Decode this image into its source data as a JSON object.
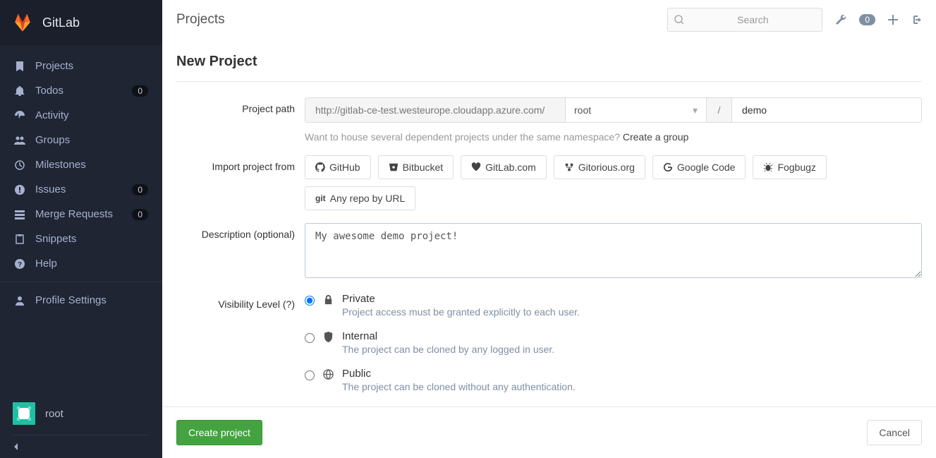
{
  "brand": "GitLab",
  "sidebar": {
    "items": [
      {
        "label": "Projects",
        "icon": "bookmark-icon"
      },
      {
        "label": "Todos",
        "icon": "bell-icon",
        "badge": "0"
      },
      {
        "label": "Activity",
        "icon": "dashboard-icon"
      },
      {
        "label": "Groups",
        "icon": "group-icon"
      },
      {
        "label": "Milestones",
        "icon": "clock-icon"
      },
      {
        "label": "Issues",
        "icon": "exclamation-icon",
        "badge": "0"
      },
      {
        "label": "Merge Requests",
        "icon": "tasks-icon",
        "badge": "0"
      },
      {
        "label": "Snippets",
        "icon": "clipboard-icon"
      },
      {
        "label": "Help",
        "icon": "question-icon"
      }
    ],
    "profile": "Profile Settings",
    "user": "root"
  },
  "topbar": {
    "title": "Projects",
    "search_placeholder": "Search",
    "todos_count": "0"
  },
  "page": {
    "title": "New Project",
    "labels": {
      "project_path": "Project path",
      "import_from": "Import project from",
      "description": "Description (optional)",
      "visibility": "Visibility Level (?)"
    },
    "path": {
      "base_url": "http://gitlab-ce-test.westeurope.cloudapp.azure.com/",
      "namespace": "root",
      "separator": "/",
      "name": "demo"
    },
    "hint_text": "Want to house several dependent projects under the same namespace? ",
    "hint_link": "Create a group",
    "imports": [
      {
        "label": "GitHub",
        "icon": "github-icon"
      },
      {
        "label": "Bitbucket",
        "icon": "bitbucket-icon"
      },
      {
        "label": "GitLab.com",
        "icon": "heart-icon"
      },
      {
        "label": "Gitorious.org",
        "icon": "gitorious-icon"
      },
      {
        "label": "Google Code",
        "icon": "google-icon"
      },
      {
        "label": "Fogbugz",
        "icon": "bug-icon"
      },
      {
        "label": "Any repo by URL",
        "icon": "git-icon",
        "prefix": "git"
      }
    ],
    "description_value": "My awesome demo project!",
    "visibility": [
      {
        "title": "Private",
        "desc": "Project access must be granted explicitly to each user.",
        "icon": "lock-icon",
        "checked": true
      },
      {
        "title": "Internal",
        "desc": "The project can be cloned by any logged in user.",
        "icon": "shield-icon",
        "checked": false
      },
      {
        "title": "Public",
        "desc": "The project can be cloned without any authentication.",
        "icon": "globe-icon",
        "checked": false
      }
    ],
    "buttons": {
      "create": "Create project",
      "cancel": "Cancel"
    }
  }
}
